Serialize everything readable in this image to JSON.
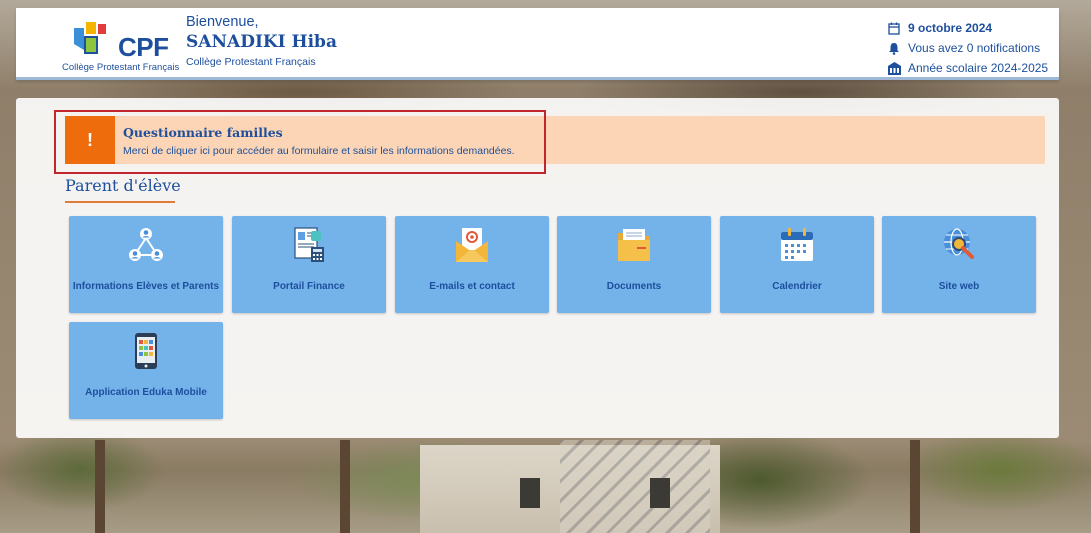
{
  "header": {
    "logo_text": "CPF",
    "logo_subtitle": "Collège Protestant Français",
    "welcome_line": "Bienvenue,",
    "user_name": "SANADIKI Hiba",
    "school_name": "Collège Protestant Français",
    "date": "9 octobre 2024",
    "notifications": "Vous avez 0 notifications",
    "school_year": "Année scolaire 2024-2025"
  },
  "alert": {
    "icon": "!",
    "title": "Questionnaire familles",
    "text": "Merci de cliquer ici pour accéder au formulaire et saisir les informations demandées."
  },
  "section": {
    "title": "Parent d'élève"
  },
  "tiles": [
    {
      "label": "Informations Elèves et Parents",
      "icon": "people-network-icon"
    },
    {
      "label": "Portail Finance",
      "icon": "finance-calculator-icon"
    },
    {
      "label": "E-mails et contact",
      "icon": "mail-envelope-icon"
    },
    {
      "label": "Documents",
      "icon": "folder-icon"
    },
    {
      "label": "Calendrier",
      "icon": "calendar-icon"
    },
    {
      "label": "Site web",
      "icon": "globe-search-icon"
    },
    {
      "label": "Application Eduka Mobile",
      "icon": "mobile-phone-icon"
    }
  ],
  "colors": {
    "brand_blue": "#1d4f9c",
    "tile_blue": "#74b2ea",
    "alert_orange": "#ef6c0d",
    "alert_bg": "#fbd5b5",
    "highlight_red": "#c0262c",
    "underline_orange": "#e07b39"
  }
}
